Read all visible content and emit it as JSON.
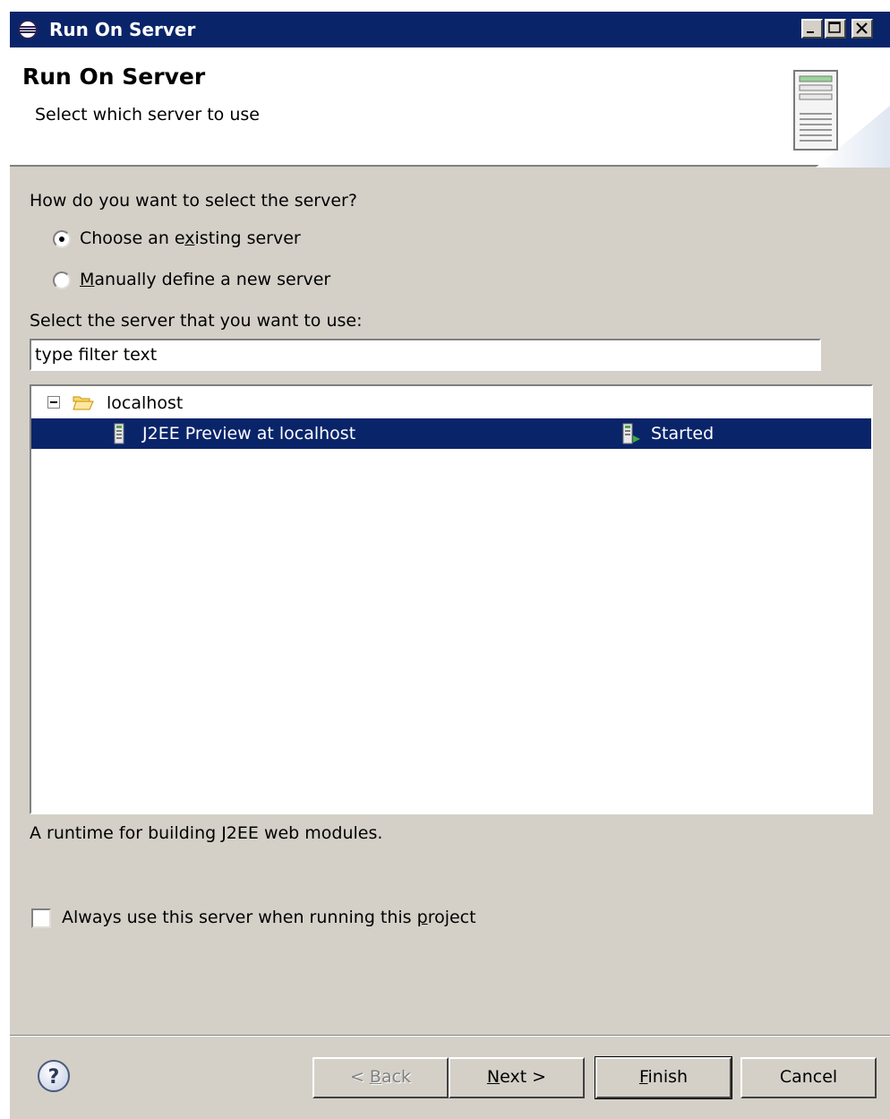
{
  "window": {
    "title": "Run On Server"
  },
  "header": {
    "title": "Run On Server",
    "subtitle": "Select which server to use"
  },
  "question": "How do you want to select the server?",
  "radio_options": [
    {
      "label_pre": "Choose an e",
      "mnemonic": "x",
      "label_post": "isting server",
      "selected": true
    },
    {
      "label_pre": "",
      "mnemonic": "M",
      "label_post": "anually define a new server",
      "selected": false
    }
  ],
  "select_label": "Select the server that you want to use:",
  "filter": {
    "value": "type filter text"
  },
  "tree": {
    "group_label": "localhost",
    "server": {
      "name": "J2EE Preview at localhost",
      "state": "Started",
      "selected": true
    }
  },
  "description": "A runtime for building J2EE web modules.",
  "always_use": {
    "label_pre": "Always use this server when running this ",
    "mnemonic": "p",
    "label_post": "roject",
    "checked": false
  },
  "buttons": {
    "back": {
      "pre": "< ",
      "mnemonic": "B",
      "post": "ack",
      "enabled": false
    },
    "next": {
      "pre": "",
      "mnemonic": "N",
      "post": "ext >",
      "enabled": true
    },
    "finish": {
      "pre": "",
      "mnemonic": "F",
      "post": "inish",
      "enabled": true
    },
    "cancel": {
      "label": "Cancel",
      "enabled": true
    }
  },
  "colors": {
    "titlebar": "#0a246a",
    "selection": "#0a246a",
    "dialog_bg": "#d4d0c8"
  }
}
